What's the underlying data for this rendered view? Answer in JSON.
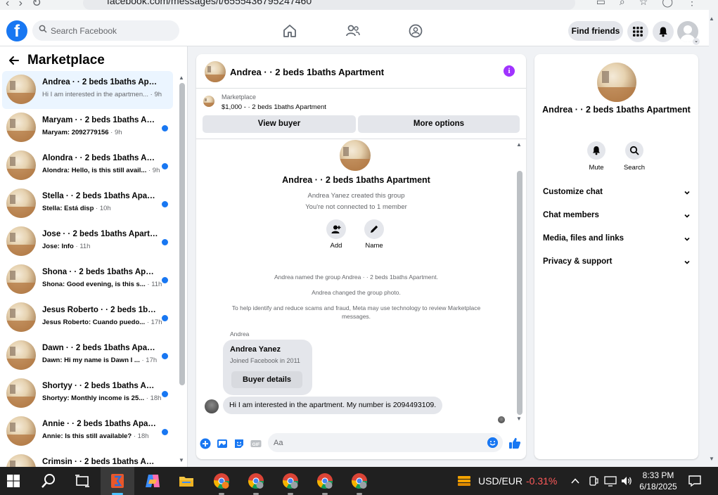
{
  "browser": {
    "url": "facebook.com/messages/t/6555436795247460"
  },
  "header": {
    "logo": "f",
    "search_placeholder": "Search Facebook",
    "find_friends": "Find friends"
  },
  "sidebar": {
    "title": "Marketplace",
    "conversations": [
      {
        "name": "Andrea · · 2 beds 1baths Apartment",
        "preview": "Hi I am interested in the apartmen...",
        "time": " · 9h",
        "unread": false,
        "active": true
      },
      {
        "name": "Maryam · · 2 beds 1baths Apartment",
        "preview": "Maryam: 2092779156",
        "time": " · 9h",
        "unread": true
      },
      {
        "name": "Alondra · · 2 beds 1baths Apartment",
        "preview": "Alondra: Hello, is this still avail...",
        "time": " · 9h",
        "unread": true
      },
      {
        "name": "Stella · · 2 beds 1baths Apartment",
        "preview": "Stella: Está disp",
        "time": " · 10h",
        "unread": true
      },
      {
        "name": "Jose · · 2 beds 1baths Apartment",
        "preview": "Jose: Info",
        "time": " · 11h",
        "unread": true
      },
      {
        "name": "Shona · · 2 beds 1baths Apartment",
        "preview": "Shona: Good evening, is this s...",
        "time": " · 11h",
        "unread": true
      },
      {
        "name": "Jesus Roberto · · 2 beds 1baths Apartment",
        "preview": "Jesus Roberto: Cuando puedo...",
        "time": " · 17h",
        "unread": true
      },
      {
        "name": "Dawn · · 2 beds 1baths Apartment",
        "preview": "Dawn: Hi my name is Dawn I ...",
        "time": " · 17h",
        "unread": true
      },
      {
        "name": "Shortyy · · 2 beds 1baths Apartment",
        "preview": "Shortyy: Monthly income is 25...",
        "time": " · 18h",
        "unread": true
      },
      {
        "name": "Annie · · 2 beds 1baths Apartment",
        "preview": "Annie: Is this still available?",
        "time": " · 18h",
        "unread": true
      },
      {
        "name": "Crimsin · · 2 beds 1baths Apartment",
        "preview": "",
        "time": "",
        "unread": true
      }
    ]
  },
  "chat": {
    "title": "Andrea · · 2 beds 1baths Apartment",
    "marketplace_label": "Marketplace",
    "listing": "$1,000 - · 2 beds 1baths Apartment",
    "view_buyer": "View buyer",
    "more_options": "More options",
    "group_title": "Andrea · · 2 beds 1baths Apartment",
    "created_by": "Andrea Yanez created this group",
    "not_connected": "You're not connected to 1 member",
    "add_label": "Add",
    "name_label": "Name",
    "note_named": "Andrea named the group Andrea · · 2 beds 1baths Apartment.",
    "note_photo": "Andrea changed the group photo.",
    "note_scam": "To help identify and reduce scams and fraud, Meta may use technology to review Marketplace messages.",
    "sender": "Andrea",
    "profile_name": "Andrea Yanez",
    "profile_joined": "Joined Facebook in 2011",
    "buyer_details": "Buyer details",
    "message": "Hi I am interested in the apartment. My number is 2094493109.",
    "composer_placeholder": "Aa"
  },
  "details": {
    "title": "Andrea · · 2 beds 1baths Apartment",
    "mute": "Mute",
    "search": "Search",
    "sections": [
      "Customize chat",
      "Chat members",
      "Media, files and links",
      "Privacy & support"
    ]
  },
  "taskbar": {
    "ticker": "USD/EUR",
    "change": "-0.31%",
    "time": "8:33 PM",
    "date": "6/18/2025"
  },
  "colors": {
    "brand_blue": "#1877f2",
    "unread_dot": "#1877f2",
    "info_purple": "#a033ff",
    "negative": "#ff5a5a"
  }
}
